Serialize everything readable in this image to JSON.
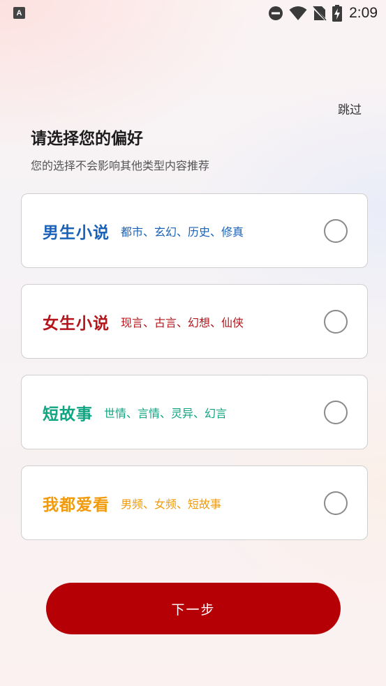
{
  "status_bar": {
    "app_icon_letter": "A",
    "time": "2:09"
  },
  "header": {
    "skip_label": "跳过",
    "title": "请选择您的偏好",
    "subtitle": "您的选择不会影响其他类型内容推荐"
  },
  "options": [
    {
      "title": "男生小说",
      "tags": "都市、玄幻、历史、修真",
      "color": "#1a62b8",
      "selected": false
    },
    {
      "title": "女生小说",
      "tags": "现言、古言、幻想、仙侠",
      "color": "#b3161c",
      "selected": false
    },
    {
      "title": "短故事",
      "tags": "世情、言情、灵异、幻言",
      "color": "#0fa482",
      "selected": false
    },
    {
      "title": "我都爱看",
      "tags": "男频、女频、短故事",
      "color": "#f09a0c",
      "selected": false
    }
  ],
  "footer": {
    "next_label": "下一步",
    "accent": "#b50006"
  },
  "icons": [
    "app-notification-icon",
    "do-not-disturb-icon",
    "wifi-icon",
    "no-sim-icon",
    "battery-charging-icon"
  ]
}
